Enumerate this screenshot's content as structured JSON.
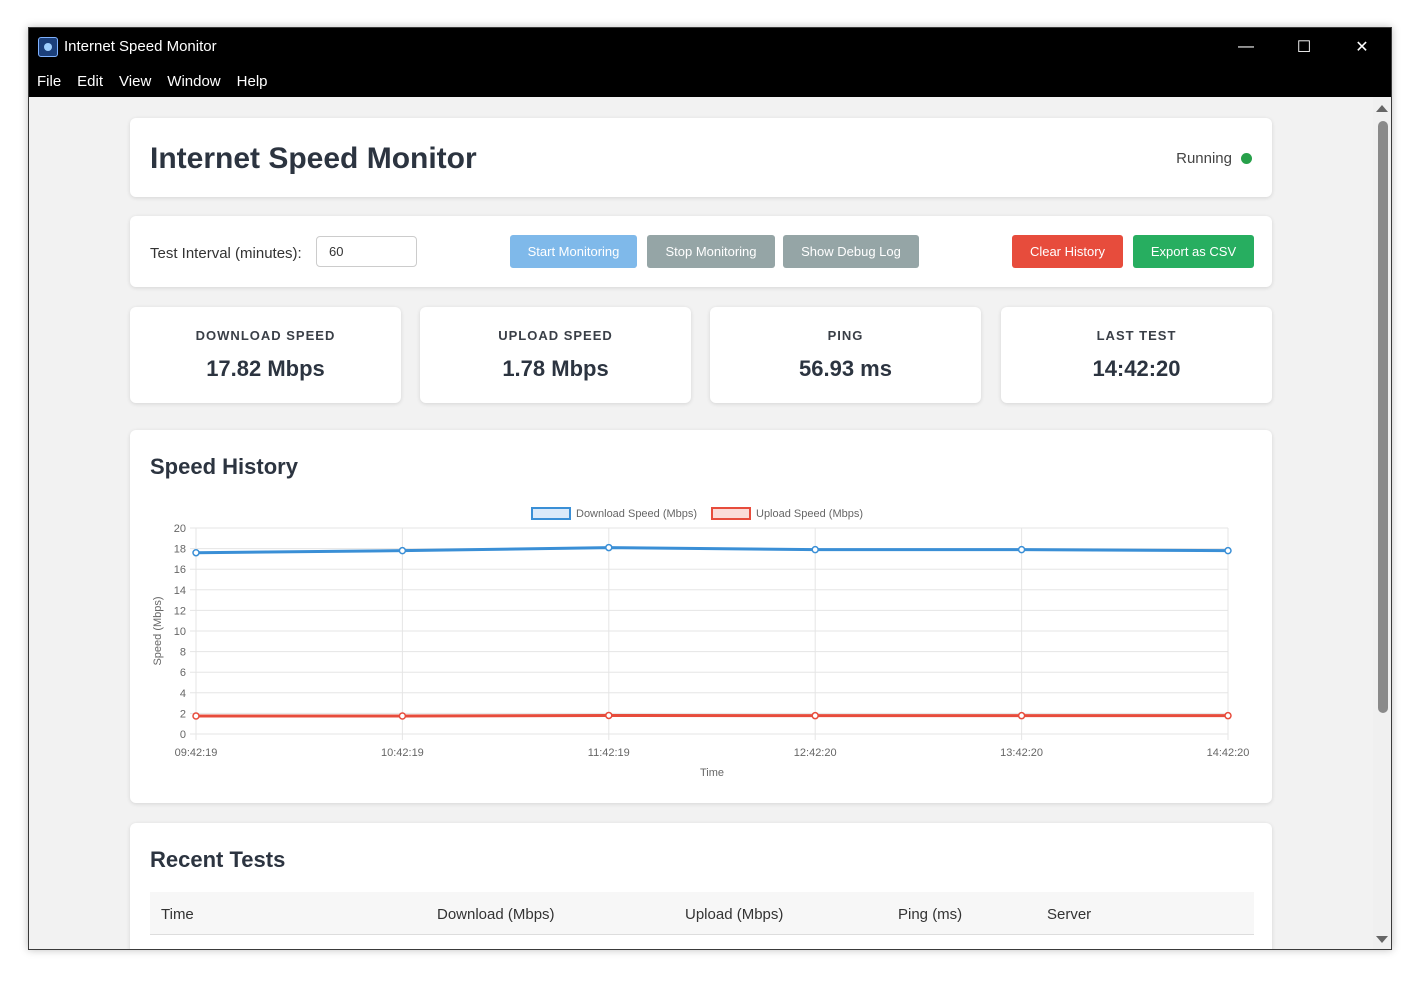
{
  "window": {
    "title": "Internet Speed Monitor",
    "controls": {
      "minimize": "—",
      "maximize": "☐",
      "close": "✕"
    }
  },
  "menu": [
    "File",
    "Edit",
    "View",
    "Window",
    "Help"
  ],
  "header": {
    "title": "Internet Speed Monitor",
    "status": "Running",
    "status_color": "#27a04a"
  },
  "controls": {
    "interval_label": "Test Interval (minutes):",
    "interval_value": "60",
    "start_label": "Start Monitoring",
    "stop_label": "Stop Monitoring",
    "debug_label": "Show Debug Log",
    "clear_label": "Clear History",
    "export_label": "Export as CSV"
  },
  "stats": [
    {
      "label": "DOWNLOAD SPEED",
      "value": "17.82 Mbps"
    },
    {
      "label": "UPLOAD SPEED",
      "value": "1.78 Mbps"
    },
    {
      "label": "PING",
      "value": "56.93 ms"
    },
    {
      "label": "LAST TEST",
      "value": "14:42:20"
    }
  ],
  "chart_section": {
    "title": "Speed History"
  },
  "chart_data": {
    "type": "line",
    "categories": [
      "09:42:19",
      "10:42:19",
      "11:42:19",
      "12:42:20",
      "13:42:20",
      "14:42:20"
    ],
    "series": [
      {
        "name": "Download Speed (Mbps)",
        "color": "#3a8fd6",
        "values": [
          17.6,
          17.8,
          18.1,
          17.9,
          17.9,
          17.8
        ]
      },
      {
        "name": "Upload Speed (Mbps)",
        "color": "#e74c3c",
        "values": [
          1.75,
          1.75,
          1.8,
          1.78,
          1.78,
          1.78
        ]
      }
    ],
    "yticks": [
      "0",
      "2",
      "4",
      "6",
      "8",
      "10",
      "12",
      "14",
      "16",
      "18",
      "20"
    ],
    "ylim": [
      0,
      20
    ],
    "xlabel": "Time",
    "ylabel": "Speed (Mbps)",
    "legend": "top-center",
    "grid": true
  },
  "recent": {
    "title": "Recent Tests",
    "columns": [
      "Time",
      "Download (Mbps)",
      "Upload (Mbps)",
      "Ping (ms)",
      "Server"
    ]
  }
}
